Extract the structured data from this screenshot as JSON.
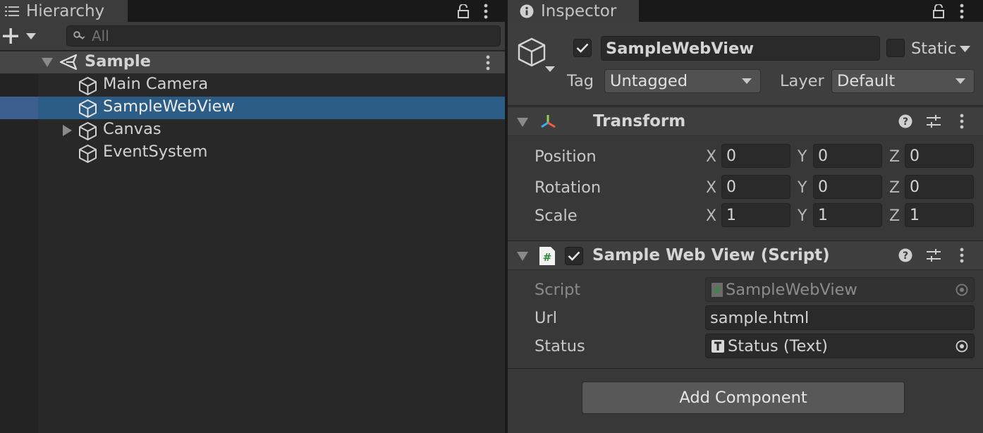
{
  "hierarchy": {
    "tab_label": "Hierarchy",
    "search_placeholder": "All",
    "scene": {
      "name": "Sample"
    },
    "items": [
      {
        "label": "Main Camera",
        "icon": "gameobject-cube-icon",
        "has_children": false,
        "selected": false
      },
      {
        "label": "SampleWebView",
        "icon": "gameobject-cube-icon",
        "has_children": false,
        "selected": true
      },
      {
        "label": "Canvas",
        "icon": "gameobject-cube-icon",
        "has_children": true,
        "selected": false
      },
      {
        "label": "EventSystem",
        "icon": "gameobject-cube-icon",
        "has_children": false,
        "selected": false
      }
    ]
  },
  "inspector": {
    "tab_label": "Inspector",
    "object_name": "SampleWebView",
    "active": true,
    "static_label": "Static",
    "static_checked": false,
    "tag_label": "Tag",
    "tag_value": "Untagged",
    "layer_label": "Layer",
    "layer_value": "Default",
    "transform": {
      "title": "Transform",
      "rows": [
        {
          "label": "Position",
          "x": "0",
          "y": "0",
          "z": "0"
        },
        {
          "label": "Rotation",
          "x": "0",
          "y": "0",
          "z": "0"
        },
        {
          "label": "Scale",
          "x": "1",
          "y": "1",
          "z": "1"
        }
      ],
      "axis_x": "X",
      "axis_y": "Y",
      "axis_z": "Z"
    },
    "script_component": {
      "title": "Sample Web View (Script)",
      "enabled": true,
      "script_label": "Script",
      "script_value": "SampleWebView",
      "url_label": "Url",
      "url_value": "sample.html",
      "status_label": "Status",
      "status_value": "Status (Text)"
    },
    "add_component_label": "Add Component"
  },
  "colors": {
    "selection": "#2c5d87",
    "panel_bg": "#282828",
    "inspector_bg": "#383838",
    "script_icon_green": "#2e8b3a"
  }
}
